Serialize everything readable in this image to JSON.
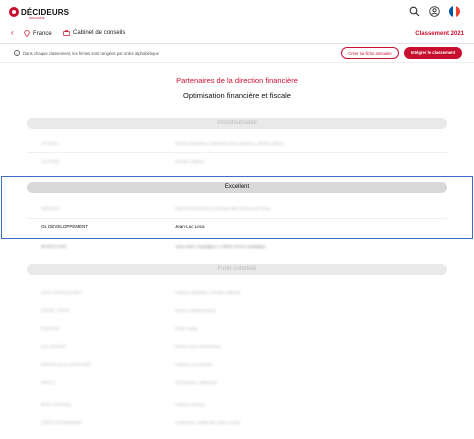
{
  "header": {
    "logo_text": "DÉCIDEURS",
    "logo_sub": "MAGAZINE",
    "flag_colors": [
      "#0055a4",
      "#ffffff",
      "#ef4135"
    ]
  },
  "breadcrumb": {
    "country": "France",
    "category": "Cabinet de conseils",
    "ranking": "Classement 2021"
  },
  "info": {
    "text": "Dans chaque classement, les firmes sont rangées par ordre alphabétique",
    "create_label": "Créer sa fiche annuaire",
    "integrate_label": "Intégrer le classement"
  },
  "title": "Partenaires de la direction financière",
  "subtitle": "Optimisation financière et fiscale",
  "tiers": [
    {
      "name": "Incontournable",
      "rows": [
        {
          "firm": "ATHERA",
          "people": "Fabien Martinez | Albertine Dos Santos | Jérôme Blanc"
        },
        {
          "firm": "LECTON",
          "people": "Florian Gallant"
        }
      ]
    },
    {
      "name": "Excellent",
      "rows": [
        {
          "firm": "ADDESS",
          "people": "Pierrick Bertrand | Christian Bill | Edouard Clivet"
        },
        {
          "firm": "OL DEVELOPPEMENT",
          "people": "Jean-Luc Leca"
        },
        {
          "firm": "INVESTAGE",
          "people": "Jean-Marc Kaladjian | Céline Perrin-Kaladjian"
        }
      ]
    },
    {
      "name": "Forte notoriété",
      "rows": [
        {
          "firm": "AFIS CONSULTING",
          "people": "Fabrice Mattiolo | Estelle Kakuze"
        },
        {
          "firm": "EXCEL TOOS",
          "people": "Patrice Maltournaud"
        },
        {
          "firm": "EQUITIS",
          "people": "Peter Haas"
        },
        {
          "firm": "KAI GROUP",
          "people": "Marie-Anne Rochebois"
        },
        {
          "firm": "KERVILLE & ASSOCIÉS",
          "people": "Fabrice Lemonnier"
        },
        {
          "firm": "PRICA",
          "people": "Christophe Vallerand"
        },
        {
          "firm": "RHG CONSEIL",
          "people": "Fabrice Dulaux"
        },
        {
          "firm": "UZES PATRIMOINE",
          "people": "Guillaume Gaillet de Saint-Avold"
        }
      ]
    }
  ]
}
